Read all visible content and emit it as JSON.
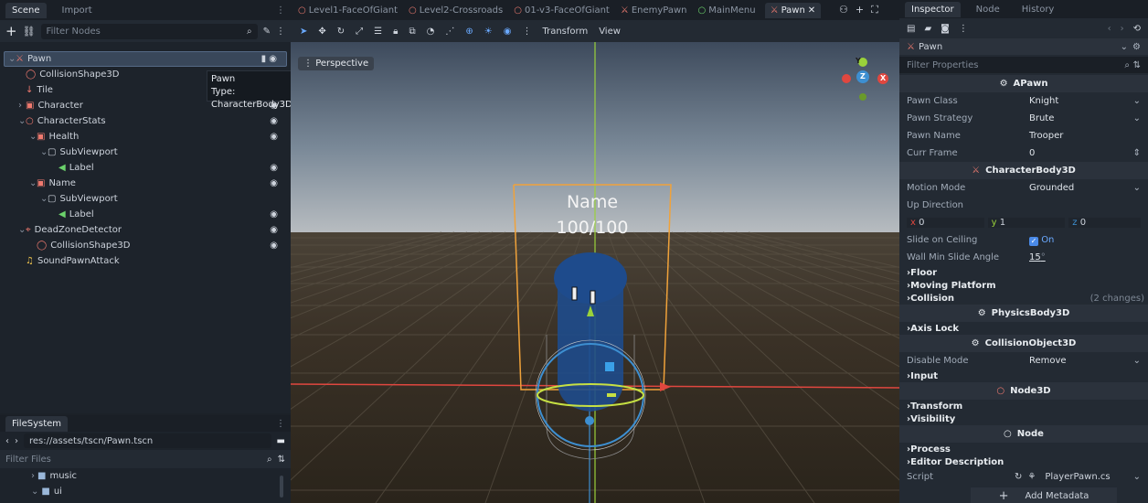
{
  "scene_dock": {
    "tabs": [
      "Scene",
      "Import"
    ],
    "filter_placeholder": "Filter Nodes",
    "nodes": [
      {
        "label": "Pawn",
        "depth": 0,
        "icon": "pawn-icon",
        "color": "#e0756b"
      },
      {
        "label": "CollisionShape3D",
        "depth": 1,
        "icon": "collision-icon",
        "color": "#f07a6f"
      },
      {
        "label": "Tile",
        "depth": 1,
        "icon": "tile-icon",
        "color": "#f07a6f"
      },
      {
        "label": "Character",
        "depth": 1,
        "icon": "control-icon",
        "color": "#f07a6f"
      },
      {
        "label": "CharacterStats",
        "depth": 1,
        "icon": "node3d-icon",
        "color": "#f07a6f"
      },
      {
        "label": "Health",
        "depth": 2,
        "icon": "control-icon",
        "color": "#f07a6f"
      },
      {
        "label": "SubViewport",
        "depth": 3,
        "icon": "subviewport-icon",
        "color": "#cdd3dc"
      },
      {
        "label": "Label",
        "depth": 4,
        "icon": "label-icon",
        "color": "#6bd26b"
      },
      {
        "label": "Name",
        "depth": 2,
        "icon": "control-icon",
        "color": "#f07a6f"
      },
      {
        "label": "SubViewport",
        "depth": 3,
        "icon": "subviewport-icon",
        "color": "#cdd3dc"
      },
      {
        "label": "Label",
        "depth": 4,
        "icon": "label-icon",
        "color": "#6bd26b"
      },
      {
        "label": "DeadZoneDetector",
        "depth": 1,
        "icon": "area-icon",
        "color": "#f07a6f"
      },
      {
        "label": "CollisionShape3D",
        "depth": 2,
        "icon": "collision-icon",
        "color": "#f07a6f"
      },
      {
        "label": "SoundPawnAttack",
        "depth": 1,
        "icon": "audio-icon",
        "color": "#f4c84e"
      }
    ],
    "tooltip_title": "Pawn",
    "tooltip_type": "Type: CharacterBody3D"
  },
  "filesystem": {
    "title": "FileSystem",
    "path": "res://assets/tscn/Pawn.tscn",
    "filter_placeholder": "Filter Files",
    "items": [
      "music",
      "ui"
    ]
  },
  "editor_tabs": [
    {
      "label": "Level1-FaceOfGiant",
      "active": false
    },
    {
      "label": "Level2-Crossroads",
      "active": false
    },
    {
      "label": "01-v3-FaceOfGiant",
      "active": false
    },
    {
      "label": "EnemyPawn",
      "active": false
    },
    {
      "label": "MainMenu",
      "active": false
    },
    {
      "label": "Pawn",
      "active": true
    }
  ],
  "viewport": {
    "toolbar_transform": "Transform",
    "toolbar_view": "View",
    "perspective_label": "Perspective",
    "overlay_name": "Name",
    "overlay_health": "100/100",
    "gizmo_y": "Y",
    "gizmo_z": "Z",
    "gizmo_x": "X"
  },
  "inspector": {
    "tabs": [
      "Inspector",
      "Node",
      "History"
    ],
    "object_name": "Pawn",
    "filter_placeholder": "Filter Properties",
    "apawn_section": "APawn",
    "props1": [
      {
        "key": "Pawn Class",
        "value": "Knight",
        "dropdown": true
      },
      {
        "key": "Pawn Strategy",
        "value": "Brute",
        "dropdown": true
      },
      {
        "key": "Pawn Name",
        "value": "Trooper",
        "dropdown": false
      },
      {
        "key": "Curr Frame",
        "value": "0",
        "dropdown": false
      }
    ],
    "cb_section": "CharacterBody3D",
    "motion_mode_key": "Motion Mode",
    "motion_mode_value": "Grounded",
    "up_direction_key": "Up Direction",
    "up_x": "0",
    "up_y": "1",
    "up_z": "0",
    "slide_ceiling_key": "Slide on Ceiling",
    "slide_ceiling_value": "On",
    "wall_slide_key": "Wall Min Slide Angle",
    "wall_slide_value": "15",
    "wall_slide_unit": "°",
    "cat_floor": "Floor",
    "cat_moving": "Moving Platform",
    "cat_collision": "Collision",
    "collision_changes": "(2 changes)",
    "pb_section": "PhysicsBody3D",
    "cat_axis": "Axis Lock",
    "co_section": "CollisionObject3D",
    "disable_mode_key": "Disable Mode",
    "disable_mode_value": "Remove",
    "cat_input": "Input",
    "n3_section": "Node3D",
    "cat_transform": "Transform",
    "cat_visibility": "Visibility",
    "node_section": "Node",
    "cat_process": "Process",
    "cat_editor_desc": "Editor Description",
    "script_key": "Script",
    "script_value": "PlayerPawn.cs",
    "add_metadata": "Add Metadata"
  }
}
